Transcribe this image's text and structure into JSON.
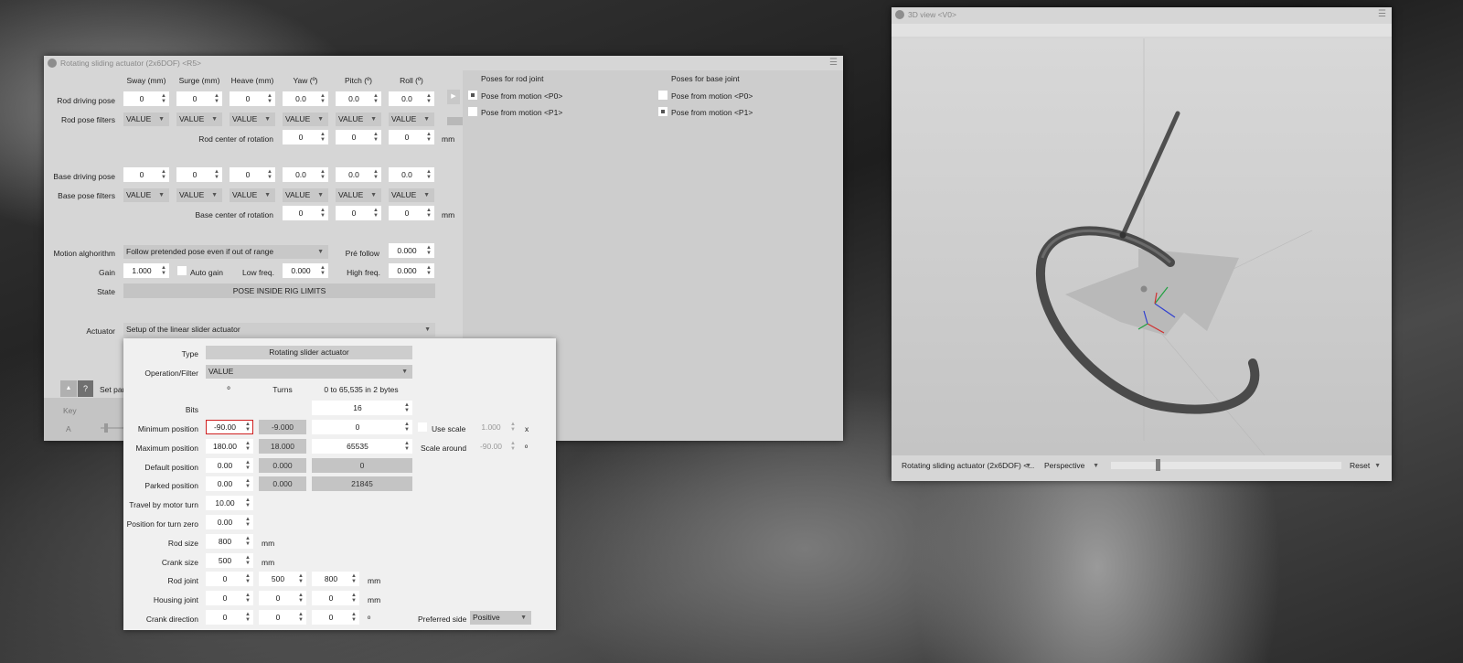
{
  "main": {
    "title": "Rotating sliding actuator (2x6DOF) <R5>",
    "col_headers": [
      "Sway (mm)",
      "Surge (mm)",
      "Heave (mm)",
      "Yaw (º)",
      "Pitch (º)",
      "Roll (º)"
    ],
    "rod_driving_pose": {
      "label": "Rod driving pose",
      "values": [
        "0",
        "0",
        "0",
        "0.0",
        "0.0",
        "0.0"
      ]
    },
    "rod_pose_filters": {
      "label": "Rod pose filters",
      "values": [
        "VALUE",
        "VALUE",
        "VALUE",
        "VALUE",
        "VALUE",
        "VALUE"
      ]
    },
    "rod_center": {
      "label": "Rod center of rotation",
      "values": [
        "0",
        "0",
        "0"
      ],
      "unit": "mm"
    },
    "base_driving_pose": {
      "label": "Base driving pose",
      "values": [
        "0",
        "0",
        "0",
        "0.0",
        "0.0",
        "0.0"
      ]
    },
    "base_pose_filters": {
      "label": "Base pose filters",
      "values": [
        "VALUE",
        "VALUE",
        "VALUE",
        "VALUE",
        "VALUE",
        "VALUE"
      ]
    },
    "base_center": {
      "label": "Base center of rotation",
      "values": [
        "0",
        "0",
        "0"
      ],
      "unit": "mm"
    },
    "motion_algorithm": {
      "label": "Motion alghorithm",
      "value": "Follow pretended pose even if out of range"
    },
    "pre_follow": {
      "label": "Pré follow",
      "value": "0.000"
    },
    "gain": {
      "label": "Gain",
      "value": "1.000"
    },
    "auto_gain": {
      "label": "Auto gain"
    },
    "low_freq": {
      "label": "Low freq.",
      "value": "0.000"
    },
    "high_freq": {
      "label": "High freq.",
      "value": "0.000"
    },
    "state": {
      "label": "State",
      "value": "POSE INSIDE RIG LIMITS"
    },
    "actuator": {
      "label": "Actuator",
      "value": "Setup of the linear slider actuator"
    },
    "help_button": "?",
    "set_params_label": "Set par",
    "key_label": "Key",
    "a_label": "A",
    "rod_poses": {
      "header": "Poses for rod joint",
      "items": [
        {
          "label": "Pose from motion <P0>",
          "checked": true
        },
        {
          "label": "Pose from motion <P1>",
          "checked": false
        }
      ]
    },
    "base_poses": {
      "header": "Poses for base joint",
      "items": [
        {
          "label": "Pose from motion <P0>",
          "checked": false
        },
        {
          "label": "Pose from motion <P1>",
          "checked": true
        }
      ]
    }
  },
  "actuator_panel": {
    "type": {
      "label": "Type",
      "value": "Rotating slider actuator"
    },
    "operation": {
      "label": "Operation/Filter",
      "value": "VALUE"
    },
    "col_deg": "º",
    "col_turns": "Turns",
    "col_range": "0 to 65,535 in 2 bytes",
    "bits": {
      "label": "Bits",
      "value": "16"
    },
    "min_position": {
      "label": "Minimum position",
      "deg": "-90.00",
      "turns": "-9.000",
      "raw": "0"
    },
    "max_position": {
      "label": "Maximum position",
      "deg": "180.00",
      "turns": "18.000",
      "raw": "65535"
    },
    "default_position": {
      "label": "Default position",
      "deg": "0.00",
      "turns": "0.000",
      "raw": "0"
    },
    "parked_position": {
      "label": "Parked position",
      "deg": "0.00",
      "turns": "0.000",
      "raw": "21845"
    },
    "use_scale": {
      "label": "Use scale",
      "value": "1.000",
      "suffix": "x"
    },
    "scale_around": {
      "label": "Scale around",
      "value": "-90.00",
      "suffix": "º"
    },
    "travel_by_turn": {
      "label": "Travel by motor turn",
      "value": "10.00"
    },
    "turn_zero": {
      "label": "Position for turn zero",
      "value": "0.00"
    },
    "rod_size": {
      "label": "Rod size",
      "value": "800",
      "unit": "mm"
    },
    "crank_size": {
      "label": "Crank size",
      "value": "500",
      "unit": "mm"
    },
    "rod_joint": {
      "label": "Rod joint",
      "values": [
        "0",
        "500",
        "800"
      ],
      "unit": "mm"
    },
    "housing_joint": {
      "label": "Housing joint",
      "values": [
        "0",
        "0",
        "0"
      ],
      "unit": "mm"
    },
    "crank_direction": {
      "label": "Crank direction",
      "values": [
        "0",
        "0",
        "0"
      ],
      "unit": "º"
    },
    "preferred_side": {
      "label": "Preferred side",
      "value": "Positive"
    }
  },
  "view3d": {
    "title": "3D view <V0>",
    "object_select": "Rotating sliding actuator (2x6DOF) <...",
    "projection": "Perspective",
    "reset": "Reset",
    "slider_level": 0.1
  }
}
